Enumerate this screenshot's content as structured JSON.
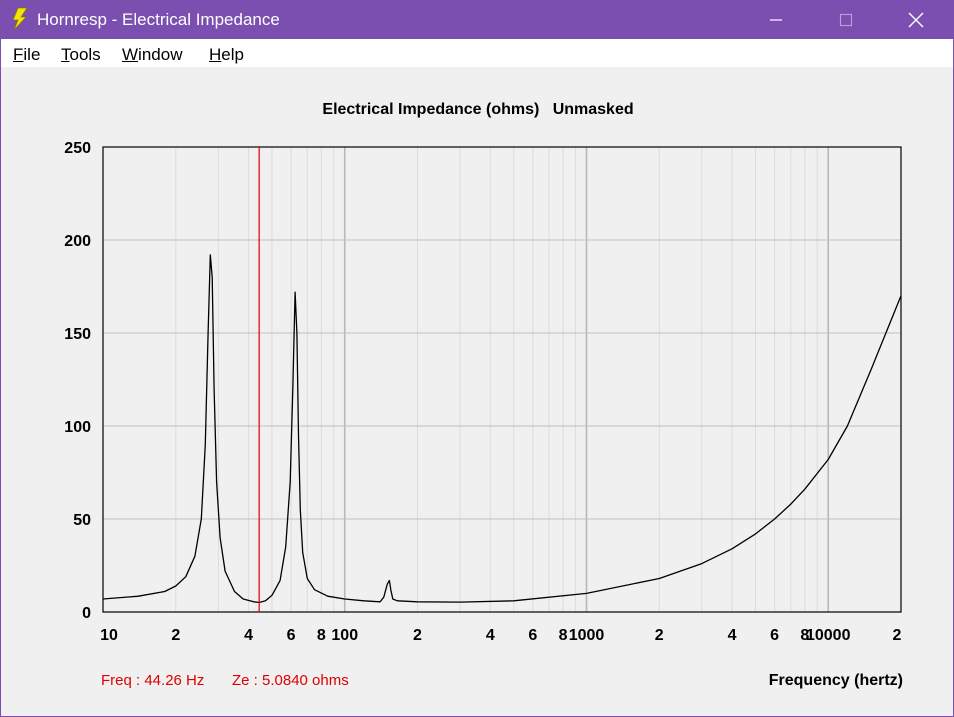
{
  "window": {
    "title": "Hornresp - Electrical Impedance",
    "accent": "#7a4fb0"
  },
  "menu": {
    "items": [
      {
        "hot": "F",
        "rest": "ile"
      },
      {
        "hot": "T",
        "rest": "ools"
      },
      {
        "hot": "W",
        "rest": "indow"
      },
      {
        "hot": "H",
        "rest": "elp"
      }
    ]
  },
  "readout": {
    "freq": "Freq : 44.26 Hz",
    "ze": "Ze : 5.0840 ohms",
    "color": "#e00000"
  },
  "chart_data": {
    "type": "line",
    "title": "Electrical Impedance (ohms)   Unmasked",
    "xlabel": "Frequency (hertz)",
    "ylabel": "",
    "x_scale": "log",
    "xlim": [
      10,
      20000
    ],
    "ylim": [
      0,
      250
    ],
    "y_ticks": [
      0,
      50,
      100,
      150,
      200,
      250
    ],
    "y_tick_labels": [
      "0",
      "50",
      "100",
      "150",
      "200",
      "250"
    ],
    "x_ticks": [
      10,
      20,
      40,
      60,
      80,
      100,
      200,
      400,
      600,
      800,
      1000,
      2000,
      4000,
      6000,
      8000,
      10000,
      20000
    ],
    "x_tick_labels": [
      "10",
      "2",
      "4",
      "6",
      "8",
      "100",
      "2",
      "4",
      "6",
      "8",
      "1000",
      "2",
      "4",
      "6",
      "8",
      "10000",
      "2"
    ],
    "grid": true,
    "cursor_x": 44.26,
    "series": [
      {
        "line_color": "#000000",
        "x": [
          10,
          14,
          18,
          20,
          22,
          24,
          25.5,
          26.5,
          27.2,
          27.8,
          28.3,
          28.8,
          29.5,
          30.5,
          32,
          35,
          38,
          42,
          44.26,
          47,
          50,
          54,
          57,
          59.5,
          61,
          62.3,
          63.4,
          64.4,
          65.5,
          67,
          70,
          75,
          85,
          100,
          120,
          140,
          145,
          150,
          153,
          155,
          158,
          165,
          200,
          300,
          500,
          1000,
          2000,
          3000,
          4000,
          5000,
          6000,
          7000,
          8000,
          10000,
          12000,
          15000,
          20000
        ],
        "y": [
          7,
          8.5,
          11,
          14,
          19,
          30,
          50,
          90,
          150,
          192,
          180,
          120,
          70,
          40,
          22,
          11,
          7,
          5.5,
          5.1,
          6,
          9,
          17,
          35,
          70,
          120,
          172,
          150,
          95,
          55,
          32,
          18,
          12,
          8.5,
          7,
          6,
          5.5,
          8,
          15,
          17,
          12,
          7,
          6,
          5.5,
          5.3,
          6,
          10,
          18,
          26,
          34,
          42,
          50,
          58,
          66,
          82,
          100,
          130,
          170
        ]
      }
    ]
  }
}
